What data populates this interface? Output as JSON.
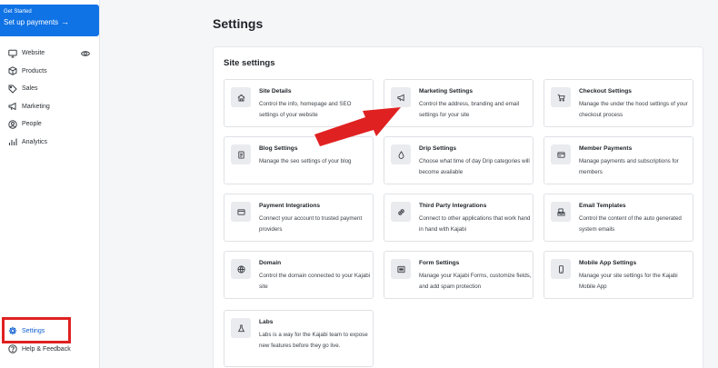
{
  "sidebar": {
    "get_started": {
      "small": "Get Started",
      "main": "Set up payments",
      "arrow": "→"
    },
    "items": [
      {
        "label": "Website",
        "icon": "monitor-icon"
      },
      {
        "label": "Products",
        "icon": "box-icon"
      },
      {
        "label": "Sales",
        "icon": "tag-icon"
      },
      {
        "label": "Marketing",
        "icon": "megaphone-icon"
      },
      {
        "label": "People",
        "icon": "person-icon"
      },
      {
        "label": "Analytics",
        "icon": "bar-chart-icon"
      }
    ],
    "bottom": [
      {
        "label": "Settings",
        "icon": "gear-icon"
      },
      {
        "label": "Help & Feedback",
        "icon": "help-icon"
      }
    ]
  },
  "page": {
    "title": "Settings"
  },
  "site_settings": {
    "title": "Site settings",
    "cards": [
      {
        "title": "Site Details",
        "desc": "Control the info, homepage and SEO settings of your website",
        "icon": "home-icon"
      },
      {
        "title": "Marketing Settings",
        "desc": "Control the address, branding and email settings for your site",
        "icon": "megaphone-icon"
      },
      {
        "title": "Checkout Settings",
        "desc": "Manage the under the hood settings of your checkout process",
        "icon": "cart-icon"
      },
      {
        "title": "Blog Settings",
        "desc": "Manage the seo settings of your blog",
        "icon": "document-icon"
      },
      {
        "title": "Drip Settings",
        "desc": "Choose what time of day Drip categories will become available",
        "icon": "drop-icon"
      },
      {
        "title": "Member Payments",
        "desc": "Manage payments and subscriptions for members",
        "icon": "receipt-icon"
      },
      {
        "title": "Payment Integrations",
        "desc": "Connect your account to trusted payment providers",
        "icon": "credit-card-icon"
      },
      {
        "title": "Third Party Integrations",
        "desc": "Connect to other applications that work hand in hand with Kajabi",
        "icon": "plug-icon"
      },
      {
        "title": "Email Templates",
        "desc": "Control the content of the auto generated system emails",
        "icon": "email-template-icon"
      },
      {
        "title": "Domain",
        "desc": "Control the domain connected to your Kajabi site",
        "icon": "globe-icon"
      },
      {
        "title": "Form Settings",
        "desc": "Manage your Kajabi Forms, customize fields, and add spam protection",
        "icon": "form-icon"
      },
      {
        "title": "Mobile App Settings",
        "desc": "Manage your site settings for the Kajabi Mobile App",
        "icon": "mobile-icon"
      },
      {
        "title": "Labs",
        "desc": "Labs is a way for the Kajabi team to expose new features before they go live.",
        "icon": "flask-icon"
      }
    ]
  },
  "colors": {
    "accent": "#0f72e5",
    "annotation": "#e02121"
  }
}
